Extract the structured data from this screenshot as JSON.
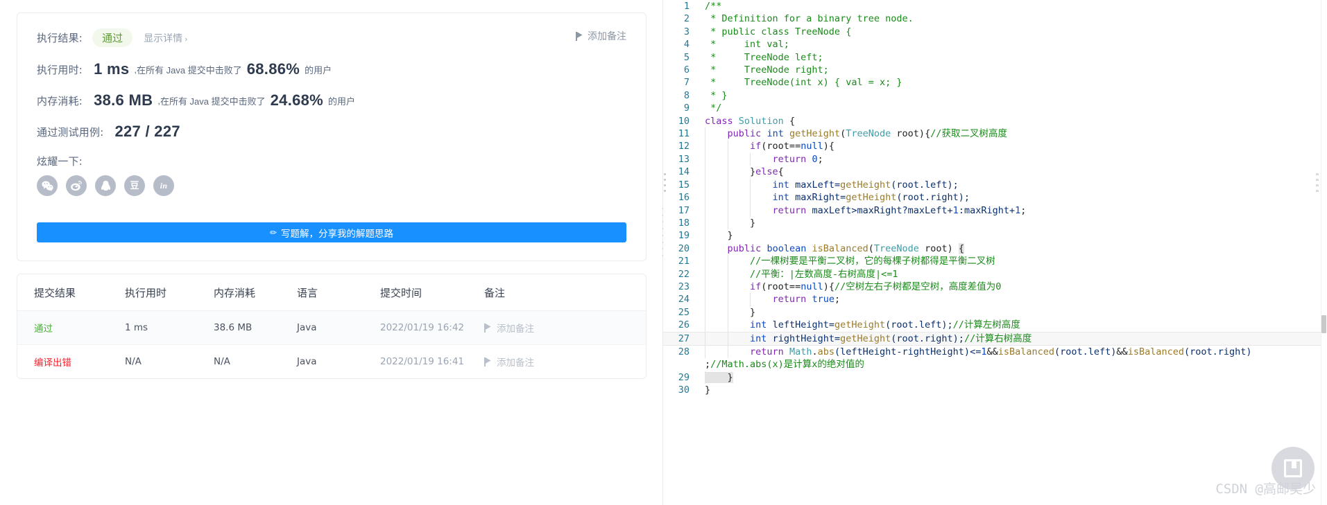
{
  "result_card": {
    "result_label": "执行结果:",
    "result_status": "通过",
    "detail_link": "显示详情",
    "detail_chevron": "›",
    "add_note_top": "添加备注",
    "runtime_label": "执行用时:",
    "runtime_value": "1 ms",
    "runtime_comma": ",",
    "runtime_prefix": "在所有 Java 提交中击败了",
    "runtime_percent": "68.86%",
    "runtime_suffix": "的用户",
    "memory_label": "内存消耗:",
    "memory_value": "38.6 MB",
    "memory_comma": ",",
    "memory_prefix": "在所有 Java 提交中击败了",
    "memory_percent": "24.68%",
    "memory_suffix": "的用户",
    "testcase_label": "通过测试用例:",
    "testcase_value": "227 / 227",
    "share_label": "炫耀一下:",
    "share_icons": [
      {
        "name": "wechat-icon",
        "glyph": ""
      },
      {
        "name": "weibo-icon",
        "glyph": ""
      },
      {
        "name": "qq-icon",
        "glyph": ""
      },
      {
        "name": "douban-icon",
        "glyph": "豆"
      },
      {
        "name": "linkedin-icon",
        "glyph": "in"
      }
    ],
    "write_solution_button": "写题解，分享我的解题思路",
    "pencil_icon": "✏"
  },
  "submissions": {
    "columns": [
      "提交结果",
      "执行用时",
      "内存消耗",
      "语言",
      "提交时间",
      "备注"
    ],
    "rows": [
      {
        "status": "通过",
        "status_kind": "pass",
        "runtime": "1 ms",
        "memory": "38.6 MB",
        "language": "Java",
        "time": "2022/01/19 16:42",
        "note": "添加备注"
      },
      {
        "status": "编译出错",
        "status_kind": "fail",
        "runtime": "N/A",
        "memory": "N/A",
        "language": "Java",
        "time": "2022/01/19 16:41",
        "note": "添加备注"
      }
    ]
  },
  "code": {
    "language": "java",
    "total_lines": 30,
    "highlighted_line": 27,
    "lines": [
      {
        "n": "1",
        "tokens": [
          {
            "t": "/**",
            "c": "c-comment"
          }
        ]
      },
      {
        "n": "2",
        "tokens": [
          {
            "t": " * Definition for a binary tree node.",
            "c": "c-comment"
          }
        ]
      },
      {
        "n": "3",
        "tokens": [
          {
            "t": " * public class TreeNode {",
            "c": "c-comment"
          }
        ]
      },
      {
        "n": "4",
        "tokens": [
          {
            "t": " *     int val;",
            "c": "c-comment"
          }
        ]
      },
      {
        "n": "5",
        "tokens": [
          {
            "t": " *     TreeNode left;",
            "c": "c-comment"
          }
        ]
      },
      {
        "n": "6",
        "tokens": [
          {
            "t": " *     TreeNode right;",
            "c": "c-comment"
          }
        ]
      },
      {
        "n": "7",
        "tokens": [
          {
            "t": " *     TreeNode(int x) { val = x; }",
            "c": "c-comment"
          }
        ]
      },
      {
        "n": "8",
        "tokens": [
          {
            "t": " * }",
            "c": "c-comment"
          }
        ]
      },
      {
        "n": "9",
        "tokens": [
          {
            "t": " */",
            "c": "c-comment"
          }
        ]
      },
      {
        "n": "10",
        "tokens": [
          {
            "t": "class",
            "c": "c-kw"
          },
          {
            "t": " ",
            "c": "c-plain"
          },
          {
            "t": "Solution",
            "c": "c-type"
          },
          {
            "t": " {",
            "c": "c-plain"
          }
        ]
      },
      {
        "n": "11",
        "tokens": [
          {
            "t": "    ",
            "c": "c-plain"
          },
          {
            "t": "public",
            "c": "c-kw"
          },
          {
            "t": " ",
            "c": "c-plain"
          },
          {
            "t": "int",
            "c": "c-kw2"
          },
          {
            "t": " ",
            "c": "c-plain"
          },
          {
            "t": "getHeight",
            "c": "c-fn"
          },
          {
            "t": "(",
            "c": "c-plain"
          },
          {
            "t": "TreeNode",
            "c": "c-type"
          },
          {
            "t": " root){",
            "c": "c-plain"
          },
          {
            "t": "//获取二叉树高度",
            "c": "c-comment"
          }
        ]
      },
      {
        "n": "12",
        "tokens": [
          {
            "t": "        ",
            "c": "c-plain"
          },
          {
            "t": "if",
            "c": "c-kw"
          },
          {
            "t": "(root==",
            "c": "c-plain"
          },
          {
            "t": "null",
            "c": "c-kw2"
          },
          {
            "t": "){",
            "c": "c-plain"
          }
        ]
      },
      {
        "n": "13",
        "tokens": [
          {
            "t": "            ",
            "c": "c-plain"
          },
          {
            "t": "return",
            "c": "c-kw"
          },
          {
            "t": " ",
            "c": "c-plain"
          },
          {
            "t": "0",
            "c": "c-num"
          },
          {
            "t": ";",
            "c": "c-plain"
          }
        ]
      },
      {
        "n": "14",
        "tokens": [
          {
            "t": "        }",
            "c": "c-plain"
          },
          {
            "t": "else",
            "c": "c-kw"
          },
          {
            "t": "{",
            "c": "c-plain"
          }
        ]
      },
      {
        "n": "15",
        "tokens": [
          {
            "t": "            ",
            "c": "c-plain"
          },
          {
            "t": "int",
            "c": "c-kw2"
          },
          {
            "t": " ",
            "c": "c-plain"
          },
          {
            "t": "maxLeft=",
            "c": "c-id"
          },
          {
            "t": "getHeight",
            "c": "c-fn"
          },
          {
            "t": "(root.left);",
            "c": "c-id"
          }
        ]
      },
      {
        "n": "16",
        "tokens": [
          {
            "t": "            ",
            "c": "c-plain"
          },
          {
            "t": "int",
            "c": "c-kw2"
          },
          {
            "t": " ",
            "c": "c-plain"
          },
          {
            "t": "maxRight=",
            "c": "c-id"
          },
          {
            "t": "getHeight",
            "c": "c-fn"
          },
          {
            "t": "(root.right);",
            "c": "c-id"
          }
        ]
      },
      {
        "n": "17",
        "tokens": [
          {
            "t": "            ",
            "c": "c-plain"
          },
          {
            "t": "return",
            "c": "c-kw"
          },
          {
            "t": " ",
            "c": "c-plain"
          },
          {
            "t": "maxLeft>maxRight?maxLeft+",
            "c": "c-id"
          },
          {
            "t": "1",
            "c": "c-num"
          },
          {
            "t": ":maxRight+",
            "c": "c-id"
          },
          {
            "t": "1",
            "c": "c-num"
          },
          {
            "t": ";",
            "c": "c-plain"
          }
        ]
      },
      {
        "n": "18",
        "tokens": [
          {
            "t": "        }",
            "c": "c-plain"
          }
        ]
      },
      {
        "n": "19",
        "tokens": [
          {
            "t": "    }",
            "c": "c-plain"
          }
        ]
      },
      {
        "n": "20",
        "tokens": [
          {
            "t": "    ",
            "c": "c-plain"
          },
          {
            "t": "public",
            "c": "c-kw"
          },
          {
            "t": " ",
            "c": "c-plain"
          },
          {
            "t": "boolean",
            "c": "c-kw2"
          },
          {
            "t": " ",
            "c": "c-plain"
          },
          {
            "t": "isBalanced",
            "c": "c-fn"
          },
          {
            "t": "(",
            "c": "c-plain"
          },
          {
            "t": "TreeNode",
            "c": "c-type"
          },
          {
            "t": " root) ",
            "c": "c-plain"
          },
          {
            "t": "{",
            "c": "c-brace"
          }
        ]
      },
      {
        "n": "21",
        "tokens": [
          {
            "t": "        ",
            "c": "c-plain"
          },
          {
            "t": "//一棵树要是平衡二叉树，它的每棵子树都得是平衡二叉树",
            "c": "c-comment"
          }
        ]
      },
      {
        "n": "22",
        "tokens": [
          {
            "t": "        ",
            "c": "c-plain"
          },
          {
            "t": "//平衡：|左数高度-右树高度|<=1",
            "c": "c-comment"
          }
        ]
      },
      {
        "n": "23",
        "tokens": [
          {
            "t": "        ",
            "c": "c-plain"
          },
          {
            "t": "if",
            "c": "c-kw"
          },
          {
            "t": "(root==",
            "c": "c-plain"
          },
          {
            "t": "null",
            "c": "c-kw2"
          },
          {
            "t": "){",
            "c": "c-plain"
          },
          {
            "t": "//空树左右子树都是空树，高度差值为0",
            "c": "c-comment"
          }
        ]
      },
      {
        "n": "24",
        "tokens": [
          {
            "t": "            ",
            "c": "c-plain"
          },
          {
            "t": "return",
            "c": "c-kw"
          },
          {
            "t": " ",
            "c": "c-plain"
          },
          {
            "t": "true",
            "c": "c-kw2"
          },
          {
            "t": ";",
            "c": "c-plain"
          }
        ]
      },
      {
        "n": "25",
        "tokens": [
          {
            "t": "        }",
            "c": "c-plain"
          }
        ]
      },
      {
        "n": "26",
        "tokens": [
          {
            "t": "        ",
            "c": "c-plain"
          },
          {
            "t": "int",
            "c": "c-kw2"
          },
          {
            "t": " ",
            "c": "c-plain"
          },
          {
            "t": "leftHeight=",
            "c": "c-id"
          },
          {
            "t": "getHeight",
            "c": "c-fn"
          },
          {
            "t": "(root.left);",
            "c": "c-id"
          },
          {
            "t": "//计算左树高度",
            "c": "c-comment"
          }
        ]
      },
      {
        "n": "27",
        "tokens": [
          {
            "t": "        ",
            "c": "c-plain"
          },
          {
            "t": "int",
            "c": "c-kw2"
          },
          {
            "t": " ",
            "c": "c-plain"
          },
          {
            "t": "rightHeight=",
            "c": "c-id"
          },
          {
            "t": "getHeight",
            "c": "c-fn"
          },
          {
            "t": "(root.right);",
            "c": "c-id"
          },
          {
            "t": "//计算右树高度",
            "c": "c-comment"
          }
        ]
      },
      {
        "n": "28",
        "tokens": [
          {
            "t": "        ",
            "c": "c-plain"
          },
          {
            "t": "return",
            "c": "c-kw"
          },
          {
            "t": " ",
            "c": "c-plain"
          },
          {
            "t": "Math",
            "c": "c-type"
          },
          {
            "t": ".",
            "c": "c-plain"
          },
          {
            "t": "abs",
            "c": "c-fn"
          },
          {
            "t": "(leftHeight-rightHeight)<=",
            "c": "c-id"
          },
          {
            "t": "1",
            "c": "c-num"
          },
          {
            "t": "&&",
            "c": "c-plain"
          },
          {
            "t": "isBalanced",
            "c": "c-fn"
          },
          {
            "t": "(root.left)",
            "c": "c-id"
          },
          {
            "t": "&&",
            "c": "c-plain"
          },
          {
            "t": "isBalanced",
            "c": "c-fn"
          },
          {
            "t": "(root.right)",
            "c": "c-id"
          }
        ]
      },
      {
        "n": "",
        "wrapped": true,
        "tokens": [
          {
            "t": ";",
            "c": "c-plain"
          },
          {
            "t": "//Math.abs(x)是计算x的绝对值的",
            "c": "c-comment"
          }
        ]
      },
      {
        "n": "29",
        "tokens": [
          {
            "t": "    }",
            "c": "c-brace"
          }
        ]
      },
      {
        "n": "30",
        "tokens": [
          {
            "t": "}",
            "c": "c-plain"
          }
        ]
      }
    ]
  },
  "watermark": {
    "text": "CSDN @高邮吴少"
  }
}
